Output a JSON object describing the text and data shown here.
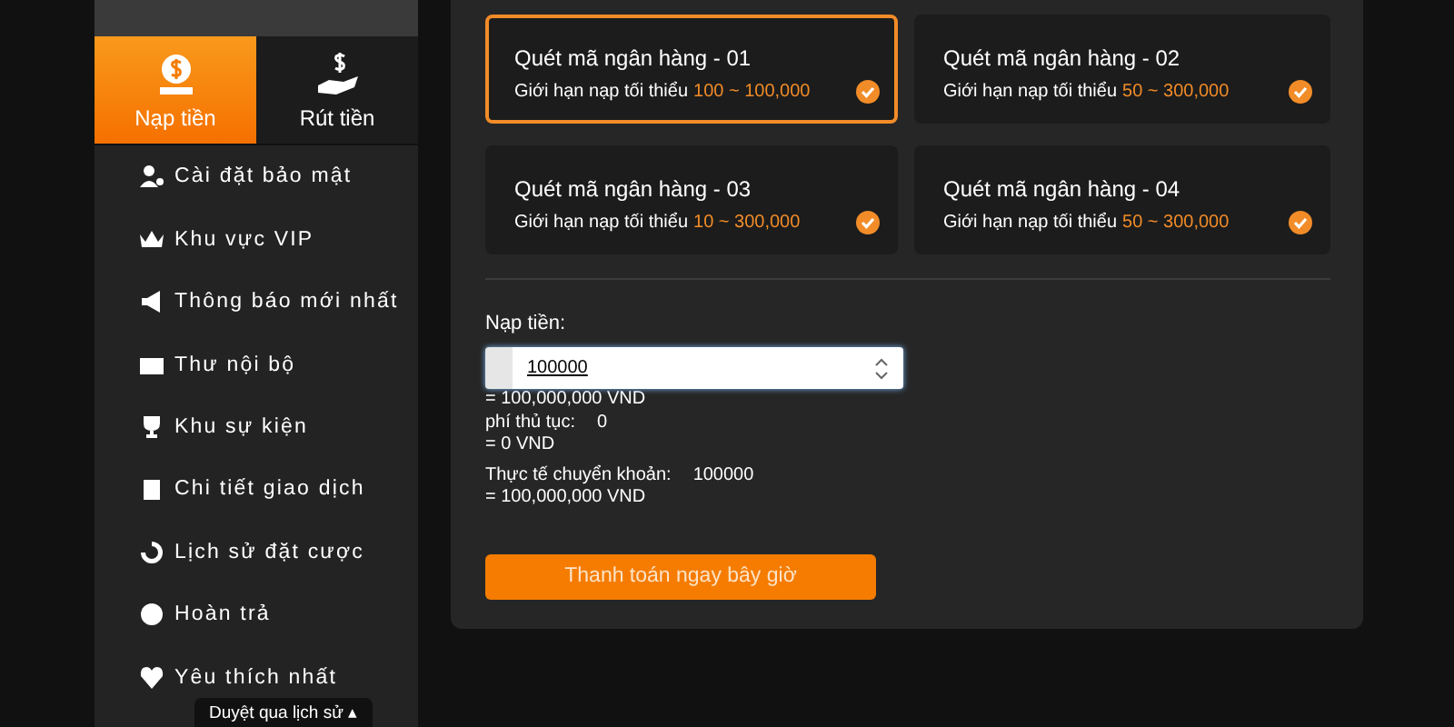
{
  "sidebar": {
    "tabs": [
      {
        "label": "Nạp tiền",
        "selected": true
      },
      {
        "label": "Rút tiền",
        "selected": false
      }
    ],
    "items": [
      "Cài đặt bảo mật",
      "Khu vực VIP",
      "Thông báo mới nhất",
      "Thư nội bộ",
      "Khu sự kiện",
      "Chi tiết giao dịch",
      "Lịch sử đặt cược",
      "Hoàn trả",
      "Yêu thích nhất"
    ],
    "history_toggle": "Duyệt qua lịch sử ▴"
  },
  "methods": [
    {
      "title": "Quét mã ngân hàng - 01",
      "limit_label": "Giới hạn nạp tối thiểu",
      "range": "100 ~ 100,000",
      "selected": true
    },
    {
      "title": "Quét mã ngân hàng - 02",
      "limit_label": "Giới hạn nạp tối thiểu",
      "range": "50 ~ 300,000",
      "selected": false
    },
    {
      "title": "Quét mã ngân hàng - 03",
      "limit_label": "Giới hạn nạp tối thiểu",
      "range": "10 ~ 300,000",
      "selected": false
    },
    {
      "title": "Quét mã ngân hàng - 04",
      "limit_label": "Giới hạn nạp tối thiểu",
      "range": "50 ~ 300,000",
      "selected": false
    }
  ],
  "form": {
    "amount_label": "Nạp tiền:",
    "amount_value": "100000",
    "amount_vnd": "= 100,000,000 VND",
    "fee_label": "phí thủ tục:",
    "fee_value": "0",
    "fee_vnd": "= 0 VND",
    "actual_label": "Thực tế chuyển khoản:",
    "actual_value": "100000",
    "actual_vnd": "= 100,000,000 VND",
    "submit": "Thanh toán ngay bây giờ"
  }
}
